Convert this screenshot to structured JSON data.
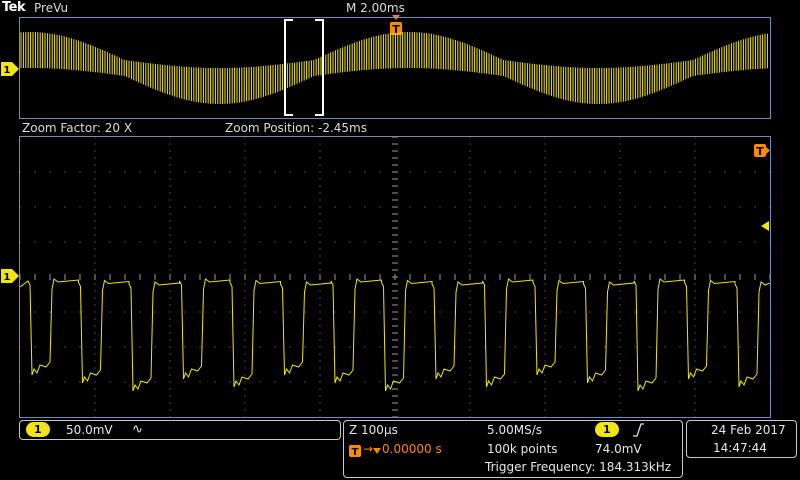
{
  "header": {
    "brand": "Tek",
    "mode": "PreVu",
    "horizontal_scale": "M 2.00ms"
  },
  "zoom": {
    "factor": "Zoom Factor: 20 X",
    "position": "Zoom Position: -2.45ms"
  },
  "markers": {
    "channel": "1",
    "trigger": "T"
  },
  "channel_panel": {
    "badge": "1",
    "scale": "50.0mV",
    "coupling_icon": "ac-coupling-icon",
    "coupling_glyph": "∿"
  },
  "acquisition_panel": {
    "zoom_timebase": "Z 100µs",
    "trigger_delay": "0.00000 s",
    "trigger_delay_prefix": "→",
    "sample_rate": "5.00MS/s",
    "record_length": "100k points",
    "trigger_source_badge": "1",
    "trigger_slope_icon": "rising-edge-icon",
    "trigger_slope_glyph": "⌠",
    "trigger_level": "74.0mV",
    "trigger_frequency": "Trigger Frequency: 184.313kHz"
  },
  "datetime": {
    "date": "24 Feb  2017",
    "time": "14:47:44"
  },
  "colors": {
    "trace": "#f3e515",
    "trigger": "#ff8a00",
    "graticule": "#6f8fb8",
    "zoom_box": "#ffffff"
  }
}
